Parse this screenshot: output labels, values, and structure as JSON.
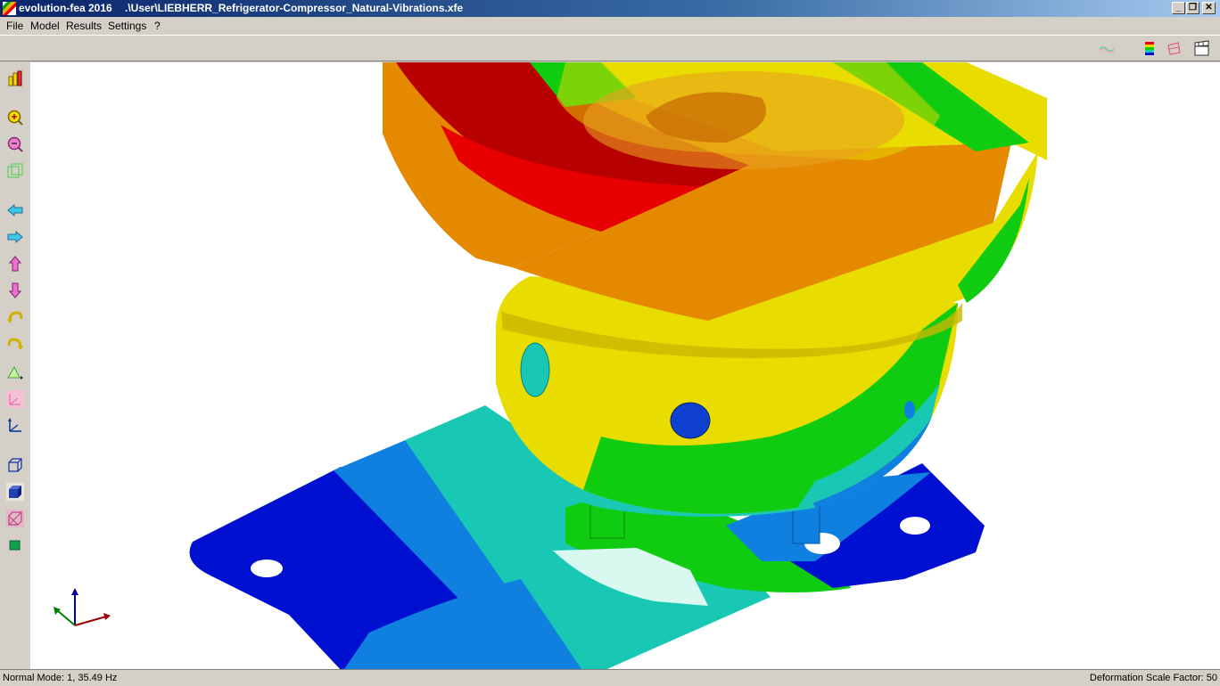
{
  "window": {
    "app_title": "evolution-fea 2016",
    "file_path": ".\\User\\LIEBHERR_Refrigerator-Compressor_Natural-Vibrations.xfe",
    "controls": {
      "minimize": "_",
      "restore": "❐",
      "close": "✕"
    }
  },
  "menu": {
    "items": [
      "File",
      "Model",
      "Results",
      "Settings",
      "?"
    ]
  },
  "top_toolbar": {
    "icons": [
      "mode-shape-wave-icon",
      "color-legend-icon",
      "deformed-mesh-icon",
      "animation-clapper-icon"
    ]
  },
  "left_toolbar": {
    "icons": [
      "bar-chart-icon",
      "zoom-in-icon",
      "zoom-out-icon",
      "zoom-extents-icon",
      "pan-left-icon",
      "pan-right-icon",
      "pan-up-icon",
      "pan-down-icon",
      "rotate-left-icon",
      "rotate-right-icon",
      "view-plane-icon",
      "axis-view-icon",
      "axes-xyz-icon",
      "wireframe-icon",
      "solid-shaded-icon",
      "hidden-lines-icon",
      "color-box-icon"
    ]
  },
  "viewport": {
    "result_colors": {
      "red": "#e80000",
      "orange": "#e58a00",
      "yellow": "#e8dc00",
      "green": "#10cc10",
      "cyan": "#18c8b4",
      "light_blue": "#1080e0",
      "blue": "#0010d0"
    }
  },
  "status": {
    "left": "Normal Mode: 1, 35.49 Hz",
    "right": "Deformation Scale Factor: 50"
  }
}
